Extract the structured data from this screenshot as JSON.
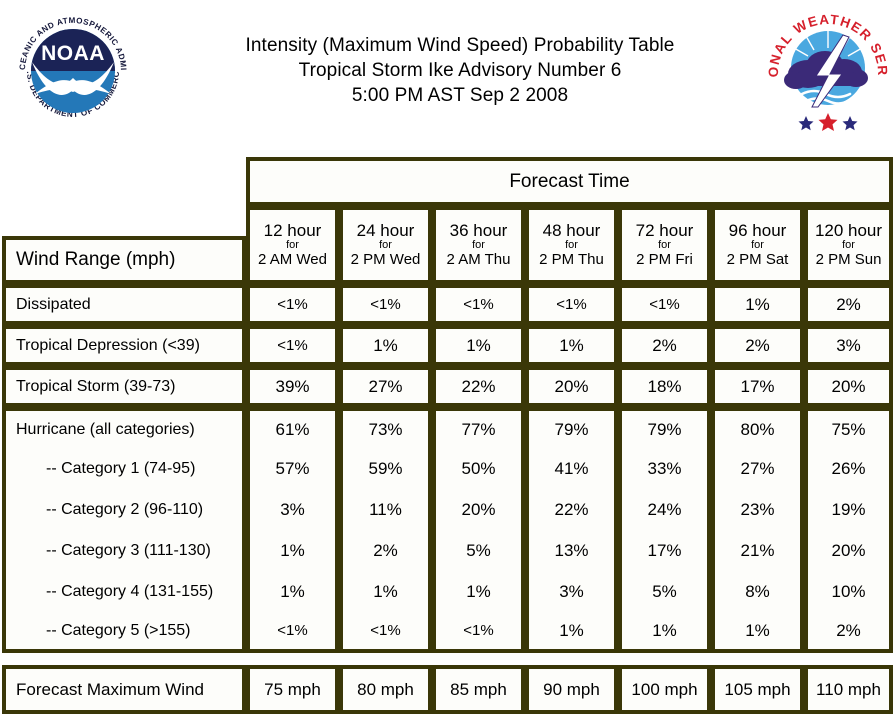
{
  "header": {
    "title_lines": [
      "Intensity (Maximum Wind Speed) Probability Table",
      "Tropical Storm Ike Advisory Number 6",
      "5:00 PM AST Sep 2 2008"
    ],
    "noaa_logo": {
      "name": "noaa-logo",
      "wordmark": "NOAA",
      "ring_text_top": "NATIONAL OCEANIC AND ATMOSPHERIC ADMINISTRATION",
      "ring_text_bottom": "U.S. DEPARTMENT OF COMMERCE",
      "colors": {
        "dark_navy": "#1b2356",
        "blue": "#2478b8",
        "white": "#ffffff",
        "ring_text": "#14173a"
      }
    },
    "nws_logo": {
      "name": "national-weather-service-logo",
      "ring_text": "NATIONAL WEATHER SERVICE",
      "colors": {
        "red": "#d6202c",
        "sky_blue": "#4aa8e0",
        "cloud_purple": "#3b2a78",
        "star_blue": "#2a2a7a",
        "white": "#ffffff"
      }
    }
  },
  "table": {
    "forecast_time_header": "Forecast Time",
    "wind_range_header": "Wind Range (mph)",
    "columns": [
      {
        "hour": "12 hour",
        "for": "for",
        "when": "2 AM Wed"
      },
      {
        "hour": "24 hour",
        "for": "for",
        "when": "2 PM Wed"
      },
      {
        "hour": "36 hour",
        "for": "for",
        "when": "2 AM Thu"
      },
      {
        "hour": "48 hour",
        "for": "for",
        "when": "2 PM Thu"
      },
      {
        "hour": "72 hour",
        "for": "for",
        "when": "2 PM Fri"
      },
      {
        "hour": "96 hour",
        "for": "for",
        "when": "2 PM Sat"
      },
      {
        "hour": "120 hour",
        "for": "for",
        "when": "2 PM Sun"
      }
    ],
    "rows": [
      {
        "label": "Dissipated",
        "indent": false,
        "values": [
          "<1%",
          "<1%",
          "<1%",
          "<1%",
          "<1%",
          "1%",
          "2%"
        ]
      },
      {
        "label": "Tropical Depression (<39)",
        "indent": false,
        "values": [
          "<1%",
          "1%",
          "1%",
          "1%",
          "2%",
          "2%",
          "3%"
        ]
      },
      {
        "label": "Tropical Storm (39-73)",
        "indent": false,
        "values": [
          "39%",
          "27%",
          "22%",
          "20%",
          "18%",
          "17%",
          "20%"
        ]
      },
      {
        "label": "Hurricane (all categories)",
        "indent": false,
        "values": [
          "61%",
          "73%",
          "77%",
          "79%",
          "79%",
          "80%",
          "75%"
        ]
      },
      {
        "label": "-- Category 1 (74-95)",
        "indent": true,
        "values": [
          "57%",
          "59%",
          "50%",
          "41%",
          "33%",
          "27%",
          "26%"
        ]
      },
      {
        "label": "-- Category 2 (96-110)",
        "indent": true,
        "values": [
          "3%",
          "11%",
          "20%",
          "22%",
          "24%",
          "23%",
          "19%"
        ]
      },
      {
        "label": "-- Category 3 (111-130)",
        "indent": true,
        "values": [
          "1%",
          "2%",
          "5%",
          "13%",
          "17%",
          "21%",
          "20%"
        ]
      },
      {
        "label": "-- Category 4 (131-155)",
        "indent": true,
        "values": [
          "1%",
          "1%",
          "1%",
          "3%",
          "5%",
          "8%",
          "10%"
        ]
      },
      {
        "label": "-- Category 5 (>155)",
        "indent": true,
        "values": [
          "<1%",
          "<1%",
          "<1%",
          "1%",
          "1%",
          "1%",
          "2%"
        ]
      }
    ],
    "footer": {
      "label": "Forecast Maximum Wind",
      "values": [
        "75 mph",
        "80 mph",
        "85 mph",
        "90 mph",
        "100 mph",
        "105 mph",
        "110 mph"
      ]
    },
    "border_color": "#3a3708"
  }
}
